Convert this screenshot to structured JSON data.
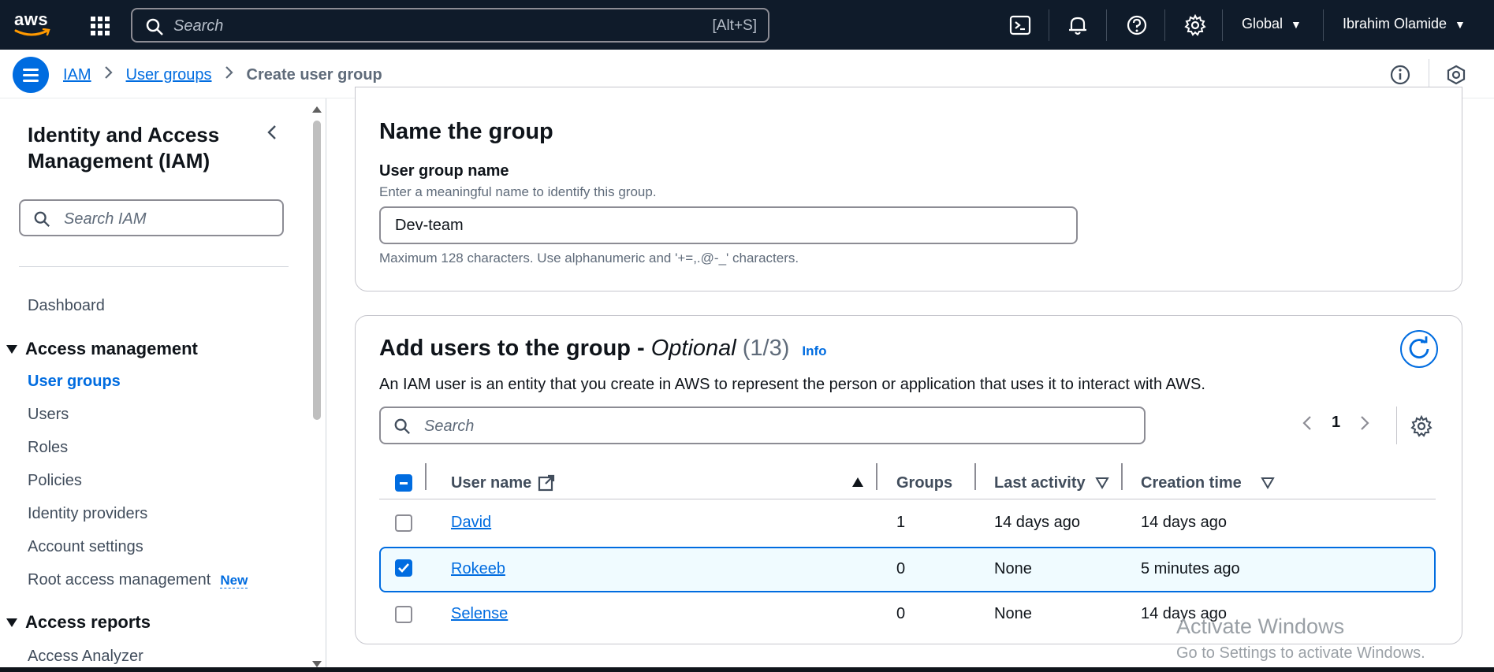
{
  "topnav": {
    "logo_text": "aws",
    "search_placeholder": "Search",
    "search_shortcut": "[Alt+S]",
    "region": "Global",
    "user": "Ibrahim Olamide"
  },
  "breadcrumb": {
    "items": [
      "IAM",
      "User groups"
    ],
    "current": "Create user group"
  },
  "sidebar": {
    "title": "Identity and Access Management (IAM)",
    "search_placeholder": "Search IAM",
    "dashboard": "Dashboard",
    "access_management": "Access management",
    "items": [
      "User groups",
      "Users",
      "Roles",
      "Policies",
      "Identity providers",
      "Account settings",
      "Root access management"
    ],
    "new_badge": "New",
    "access_reports": "Access reports",
    "access_analyzer": "Access Analyzer"
  },
  "name_group": {
    "heading": "Name the group",
    "label": "User group name",
    "description": "Enter a meaningful name to identify this group.",
    "value": "Dev-team",
    "hint": "Maximum 128 characters. Use alphanumeric and '+=,.@-_' characters."
  },
  "add_users": {
    "heading": "Add users to the group -",
    "optional": "Optional",
    "count": "(1/3)",
    "info": "Info",
    "description": "An IAM user is an entity that you create in AWS to represent the person or application that uses it to interact with AWS.",
    "search_placeholder": "Search",
    "page": "1",
    "columns": [
      "User name",
      "Groups",
      "Last activity",
      "Creation time"
    ],
    "rows": [
      {
        "name": "David",
        "groups": "1",
        "last_activity": "14 days ago",
        "created": "14 days ago",
        "selected": false
      },
      {
        "name": "Rokeeb",
        "groups": "0",
        "last_activity": "None",
        "created": "5 minutes ago",
        "selected": true
      },
      {
        "name": "Selense",
        "groups": "0",
        "last_activity": "None",
        "created": "14 days ago",
        "selected": false
      }
    ]
  },
  "watermark": {
    "line1": "Activate Windows",
    "line2": "Go to Settings to activate Windows."
  },
  "colors": {
    "nav_bg": "#0f1b2a",
    "accent": "#006ce0"
  }
}
